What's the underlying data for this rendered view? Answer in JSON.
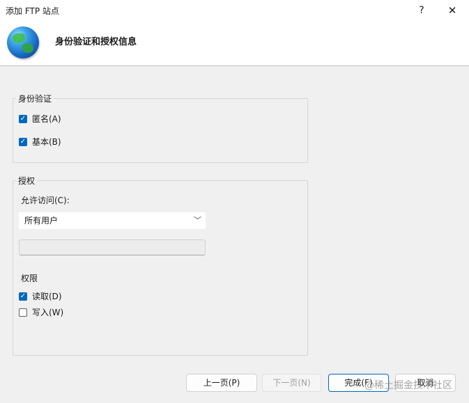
{
  "window": {
    "title": "添加 FTP 站点",
    "help_glyph": "?",
    "close_glyph": "✕"
  },
  "header": {
    "title": "身份验证和授权信息",
    "icon": "globe-icon"
  },
  "authentication": {
    "group_label": "身份验证",
    "anonymous": {
      "label": "匿名(A)",
      "checked": true
    },
    "basic": {
      "label": "基本(B)",
      "checked": true
    }
  },
  "authorization": {
    "group_label": "授权",
    "allow_access_label": "允许访问(C):",
    "allow_access_value": "所有用户",
    "permissions_label": "权限",
    "read": {
      "label": "读取(D)",
      "checked": true
    },
    "write": {
      "label": "写入(W)",
      "checked": false
    }
  },
  "buttons": {
    "previous": "上一页(P)",
    "next": "下一页(N)",
    "finish": "完成(F)",
    "cancel": "取消"
  },
  "watermark": "@稀土掘金技术社区",
  "colors": {
    "accent": "#0067c0",
    "panel_bg": "#f0f0f0"
  }
}
